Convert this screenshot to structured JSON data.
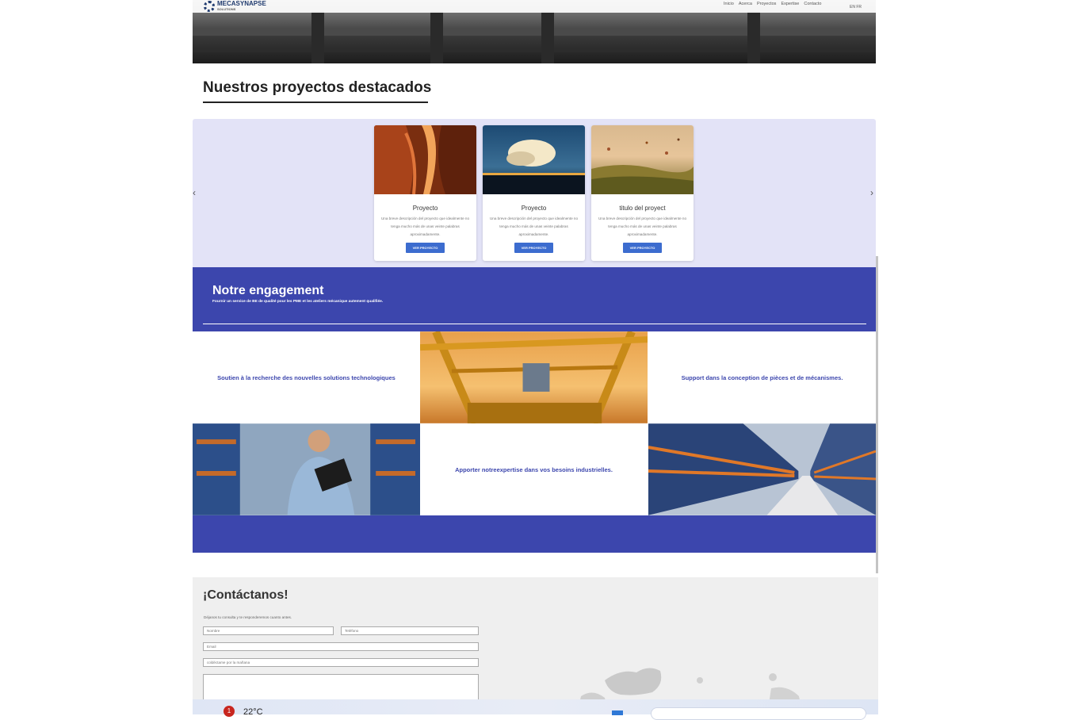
{
  "header": {
    "logo_text": "MECASYNAPSE",
    "logo_sub": "SOLUTIONS",
    "nav": [
      "Inicio",
      "Acerca",
      "Proyectos",
      "Expertise",
      "Contacto"
    ],
    "lang": "EN FR"
  },
  "projects": {
    "title": "Nuestros proyectos destacados",
    "cards": [
      {
        "title": "Proyecto",
        "desc": "Una breve descripción del proyecto que idealmente no tenga mucho más de unas veinte palabras aproximadamente.",
        "button": "VER PROYECTO"
      },
      {
        "title": "Proyecto",
        "desc": "Una breve descripción del proyecto que idealmente no tenga mucho más de unas veinte palabras aproximadamente.",
        "button": "VER PROYECTO"
      },
      {
        "title": "titulo del proyect",
        "desc": "Una breve descripción del proyecto que idealmente no tenga mucho más de unas veinte palabras aproximadamente.",
        "button": "VER PROYECTO"
      }
    ]
  },
  "engagement": {
    "title": "Notre engagement",
    "subtitle": "Fournir un service de BE de qualité pour les PME et les ateliers mécanique autement qualifiée.",
    "items": [
      "Soutien à la recherche des nouvelles solutions technologiques",
      "Support dans la conception de pièces et de mécanismes.",
      "Apporter notreexpertise dans vos besoins industrielles."
    ]
  },
  "contact": {
    "title": "¡Contáctanos!",
    "lead": "Déjanos tu consulta y te responderemos cuanto antes.",
    "name_ph": "Nombre",
    "phone_ph": "Teléfono",
    "email_ph": "Email",
    "subject_value": "coldéctame por la mañana"
  },
  "taskbar": {
    "notification_count": "1",
    "temperature": "22°C"
  },
  "colors": {
    "accent": "#3c46ad",
    "button": "#3c6ccf",
    "carousel_bg": "#e3e3f7"
  }
}
